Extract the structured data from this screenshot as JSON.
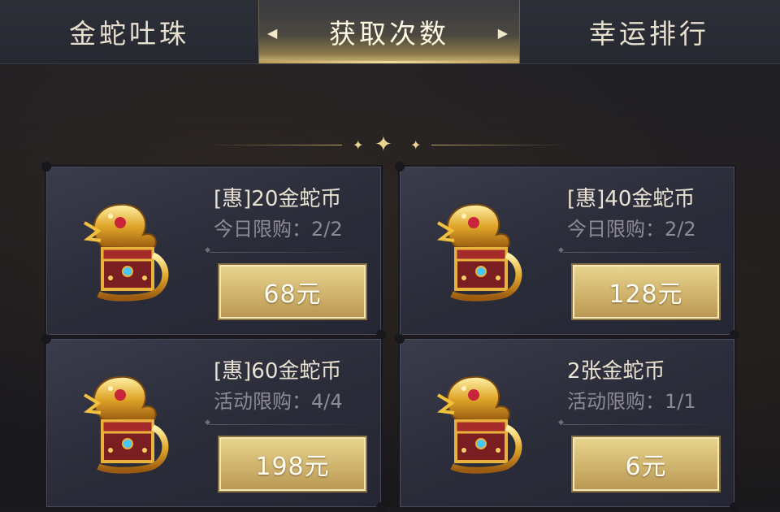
{
  "tabs": [
    {
      "label": "金蛇吐珠",
      "active": false
    },
    {
      "label": "获取次数",
      "active": true
    },
    {
      "label": "幸运排行",
      "active": false
    }
  ],
  "cards": [
    {
      "title": "[惠]20金蛇币",
      "limit": "今日限购：2/2",
      "price": "68元",
      "icon": "golden-dragon-chest-icon"
    },
    {
      "title": "[惠]40金蛇币",
      "limit": "今日限购：2/2",
      "price": "128元",
      "icon": "golden-dragon-chest-icon"
    },
    {
      "title": "[惠]60金蛇币",
      "limit": "活动限购：4/4",
      "price": "198元",
      "icon": "golden-dragon-chest-icon"
    },
    {
      "title": "2张金蛇币",
      "limit": "活动限购：1/1",
      "price": "6元",
      "icon": "golden-dragon-chest-icon"
    }
  ],
  "colors": {
    "accent_gold": "#d4bb78",
    "card_bg": "#2b2c39",
    "tab_bg": "#2e3039"
  }
}
